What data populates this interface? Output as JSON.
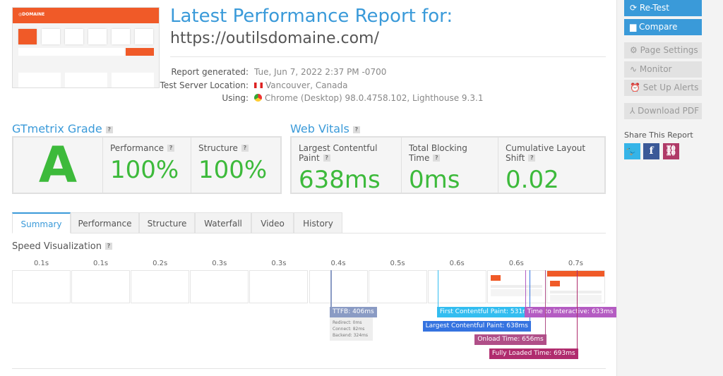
{
  "report": {
    "title": "Latest Performance Report for:",
    "url": "https://outilsdomaine.com/",
    "thumbnail": {
      "logo": "DOMAINE"
    },
    "info": [
      {
        "label": "Report generated:",
        "value": "Tue, Jun 7, 2022 2:37 PM -0700",
        "icon": ""
      },
      {
        "label": "Test Server Location:",
        "value": "Vancouver, Canada",
        "icon": "canada-flag-icon"
      },
      {
        "label": "Using:",
        "value": "Chrome (Desktop) 98.0.4758.102, Lighthouse 9.3.1",
        "icon": "chrome-icon"
      }
    ]
  },
  "grade": {
    "heading": "GTmetrix Grade",
    "help": "?",
    "letter": "A",
    "performance_label": "Performance",
    "performance": "100%",
    "structure_label": "Structure",
    "structure": "100%"
  },
  "vitals": {
    "heading": "Web Vitals",
    "help": "?",
    "lcp_label": "Largest Contentful Paint",
    "lcp": "638ms",
    "tbt_label": "Total Blocking Time",
    "tbt": "0ms",
    "cls_label": "Cumulative Layout Shift",
    "cls": "0.02"
  },
  "tabs": [
    "Summary",
    "Performance",
    "Structure",
    "Waterfall",
    "Video",
    "History"
  ],
  "speed": {
    "heading": "Speed Visualization",
    "help": "?",
    "frames": [
      "0.1s",
      "0.1s",
      "0.2s",
      "0.3s",
      "0.3s",
      "0.4s",
      "0.5s",
      "0.6s",
      "0.6s",
      "0.7s"
    ],
    "markers": [
      {
        "label": "TTFB: 406ms",
        "ms": 406,
        "color": "#8a9bc4"
      },
      {
        "label": "First Contentful Paint: 531ms",
        "ms": 531,
        "color": "#33bdf0"
      },
      {
        "label": "Largest Contentful Paint: 638ms",
        "ms": 638,
        "color": "#3573e0"
      },
      {
        "label": "Time to Interactive: 633ms",
        "ms": 633,
        "color": "#b45cc2"
      },
      {
        "label": "Onload Time: 656ms",
        "ms": 656,
        "color": "#b04f88"
      },
      {
        "label": "Fully Loaded Time: 693ms",
        "ms": 693,
        "color": "#b02c6e"
      }
    ],
    "ttfb_details": [
      "Redirect: 0ms",
      "Connect: 82ms",
      "Backend: 324ms"
    ]
  },
  "sidebar": {
    "retest": "Re-Test",
    "compare": "Compare",
    "page_settings": "Page Settings",
    "monitor": "Monitor",
    "alerts": "Set Up Alerts",
    "pdf": "Download PDF",
    "share_heading": "Share This Report"
  },
  "colors": {
    "accent": "#3a9ad9",
    "grade": "#3dba3b",
    "brand": "#f05a28",
    "twitter": "#35b4e8",
    "facebook": "#3b5998",
    "link": "#b03a68"
  }
}
